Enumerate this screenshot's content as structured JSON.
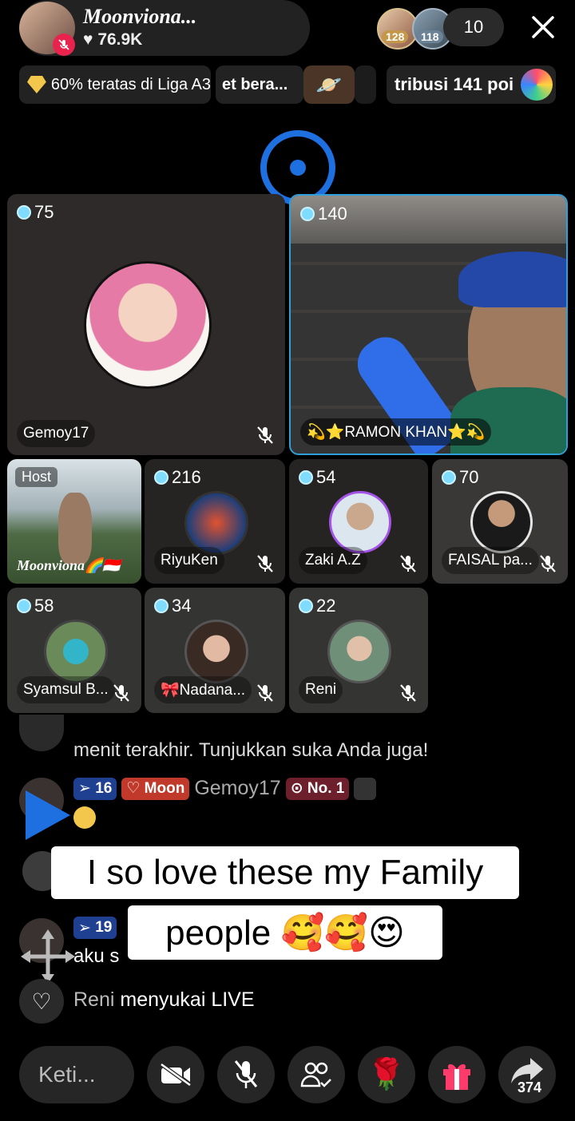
{
  "header": {
    "host_name": "Moonviona...",
    "likes": "76.9K",
    "viewer_badges": [
      "128",
      "118"
    ],
    "viewer_count": "10"
  },
  "chips": {
    "league": "60% teratas di Liga A3",
    "event": "et bera...",
    "contribution": "tribusi 141 poi"
  },
  "tiles": [
    {
      "score": "75",
      "name": "Gemoy17"
    },
    {
      "score": "140",
      "name": "💫⭐RAMON KHAN⭐💫"
    },
    {
      "label": "Host",
      "name": "Moonviona🌈🇮🇩"
    },
    {
      "score": "216",
      "name": "RiyuKen"
    },
    {
      "score": "54",
      "name": "Zaki A.Z"
    },
    {
      "score": "70",
      "name": "FAISAL pa..."
    },
    {
      "score": "58",
      "name": "Syamsul B..."
    },
    {
      "score": "34",
      "name": "🎀Nadana..."
    },
    {
      "score": "22",
      "name": "Reni"
    }
  ],
  "chat": {
    "system_partial": "menit terakhir. Tunjukkan suka Anda juga!",
    "msg1": {
      "level": "16",
      "fan_badge": "Moon",
      "user": "Gemoy17",
      "rank": "No. 1"
    },
    "msg2": {
      "level": "19",
      "text_partial": "aku s"
    },
    "like_user": "Reni",
    "like_text": "menyukai LIVE"
  },
  "caption": {
    "line1": "I so love these my Family",
    "line2": "people 🥰🥰😍"
  },
  "bottom": {
    "comment_placeholder": "Keti...",
    "share_count": "374"
  },
  "colors": {
    "accent_blue": "#1e6fe0",
    "mute_red": "#e8244e",
    "fan_badge": "#c0392b"
  }
}
